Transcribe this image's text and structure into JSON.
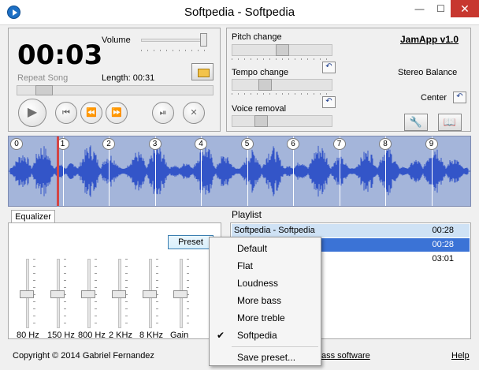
{
  "window": {
    "title": "Softpedia - Softpedia",
    "minimize": "—",
    "maximize": "☐",
    "close": "✕"
  },
  "player": {
    "time": "00:03",
    "repeat": "Repeat Song",
    "volume_label": "Volume",
    "length": "Length: 00:31",
    "volume_level": 0.95,
    "seek_position": 0.1,
    "buttons": {
      "play": "▶",
      "prev": "⏮",
      "rewind": "⏪",
      "forward": "⏩",
      "pause": "⏯",
      "stop": "✕"
    }
  },
  "controls": {
    "app_name": "JamApp v1.0",
    "pitch_label": "Pitch change",
    "tempo_label": "Tempo change",
    "voice_label": "Voice removal",
    "stereo_label": "Stereo Balance",
    "stereo_value": "Center",
    "reset_glyph": "↶",
    "tools_glyph": "🔧",
    "book_glyph": "📖",
    "pitch_value": 0.5,
    "tempo_value": 0.3,
    "voice_value": 0.25
  },
  "waveform": {
    "markers": [
      "0",
      "1",
      "2",
      "3",
      "4",
      "5",
      "6",
      "7",
      "8",
      "9"
    ],
    "playhead": 0.1,
    "colors": {
      "background": "#a4b5da",
      "wave": "#3355c8",
      "playhead": "#d44545"
    }
  },
  "equalizer": {
    "tab": "Equalizer",
    "preset_button": "Preset",
    "bands": [
      {
        "label": "80 Hz",
        "level": 0.5
      },
      {
        "label": "150 Hz",
        "level": 0.5
      },
      {
        "label": "800 Hz",
        "level": 0.5
      },
      {
        "label": "2 KHz",
        "level": 0.5
      },
      {
        "label": "8 KHz",
        "level": 0.5
      },
      {
        "label": "Gain",
        "level": 0.5
      }
    ]
  },
  "playlist": {
    "title": "Playlist",
    "rows": [
      {
        "name": "Softpedia - Softpedia",
        "duration": "00:28",
        "state": "highlight"
      },
      {
        "name": "",
        "duration": "00:28",
        "state": "selected"
      },
      {
        "name": "",
        "duration": "03:01",
        "state": "normal"
      }
    ]
  },
  "preset_menu": {
    "items": [
      {
        "label": "Default",
        "checked": false
      },
      {
        "label": "Flat",
        "checked": false
      },
      {
        "label": "Loudness",
        "checked": false
      },
      {
        "label": "More bass",
        "checked": false
      },
      {
        "label": "More treble",
        "checked": false
      },
      {
        "label": "Softpedia",
        "checked": true
      }
    ],
    "save": "Save preset..."
  },
  "footer": {
    "copyright": "Copyright © 2014 Gabriel Fernandez",
    "link": "ass software",
    "help": "Help"
  }
}
